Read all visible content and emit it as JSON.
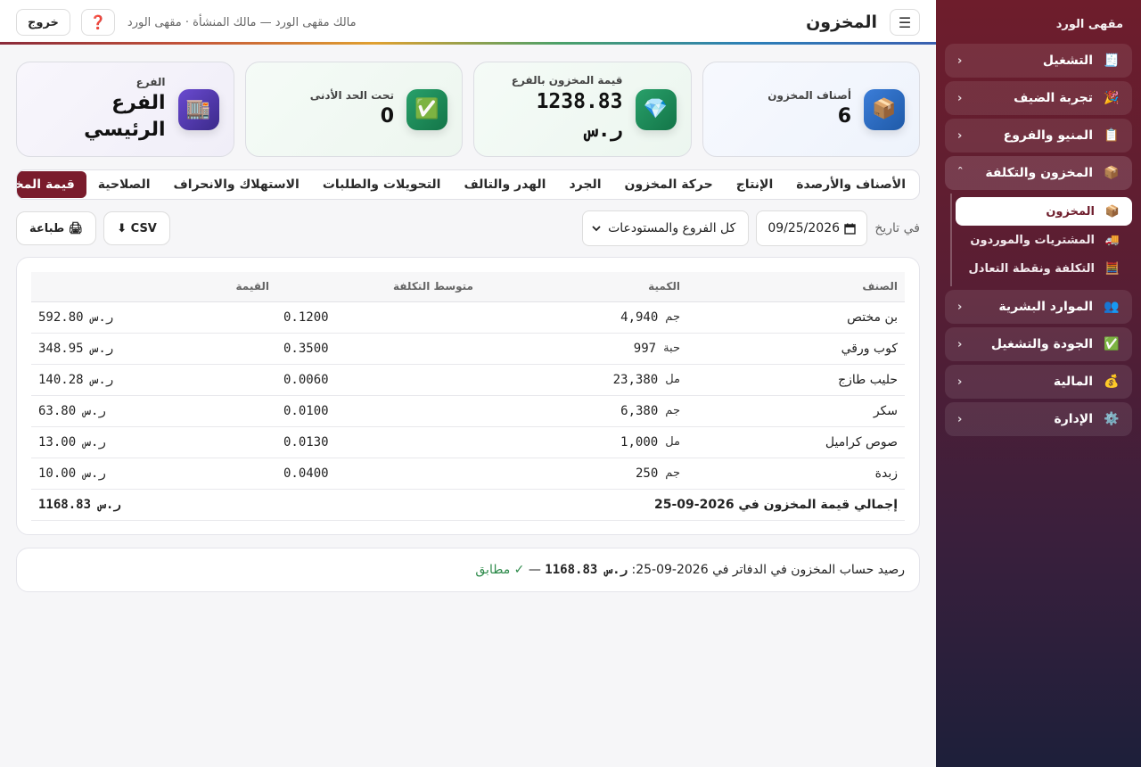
{
  "sidebar": {
    "brand": "مقهى الورد",
    "items": [
      {
        "icon": "🧾",
        "label": "التشغيل",
        "chevron": "‹"
      },
      {
        "icon": "🎉",
        "label": "تجربة الضيف",
        "chevron": "‹"
      },
      {
        "icon": "📋",
        "label": "المنيو والفروع",
        "chevron": "‹"
      },
      {
        "icon": "📦",
        "label": "المخزون والتكلفة",
        "chevron": "‹"
      },
      {
        "icon": "👥",
        "label": "الموارد البشرية",
        "chevron": "‹"
      },
      {
        "icon": "✅",
        "label": "الجودة والتشغيل",
        "chevron": "‹"
      },
      {
        "icon": "💰",
        "label": "المالية",
        "chevron": "‹"
      },
      {
        "icon": "⚙️",
        "label": "الإدارة",
        "chevron": "‹"
      }
    ],
    "sub_items": [
      {
        "icon": "📦",
        "label": "المخزون"
      },
      {
        "icon": "🚚",
        "label": "المشتريات والموردون"
      },
      {
        "icon": "🧮",
        "label": "التكلفة ونقطة التعادل"
      }
    ]
  },
  "topbar": {
    "menu_icon": "☰",
    "title": "المخزون",
    "breadcrumb": "مالك مقهى الورد — مالك المنشأة · مقهى الورد",
    "help_icon": "❓",
    "logout": "خروج"
  },
  "kpis": [
    {
      "icon": "📦",
      "label": "أصناف المخزون",
      "value": "6"
    },
    {
      "icon": "💎",
      "label": "قيمة المخزون بالفرع",
      "value": "1238.83",
      "unit": "ر.س"
    },
    {
      "icon": "✅",
      "label": "تحت الحد الأدنى",
      "value": "0"
    },
    {
      "icon": "🏬",
      "label": "الفرع",
      "value": "الفرع الرئيسي"
    }
  ],
  "tabs": [
    "الأصناف والأرصدة",
    "الإنتاج",
    "حركة المخزون",
    "الجرد",
    "الهدر والتالف",
    "التحويلات والطلبات",
    "الاستهلاك والانحراف",
    "الصلاحية",
    "قيمة المخزون"
  ],
  "filters": {
    "date_label": "في تاريخ",
    "date_value": "09/25/2026",
    "branch_select": "كل الفروع والمستودعات",
    "csv_button": "CSV ⬇",
    "print_button": "🖨 طباعة"
  },
  "table": {
    "headers": [
      "الصنف",
      "الكمية",
      "متوسط التكلفة",
      "القيمة"
    ],
    "rows": [
      {
        "name": "بن مختص",
        "unit": "جم",
        "qty": "4,940",
        "avg": "0.1200",
        "value": "ر.س 592.80"
      },
      {
        "name": "كوب ورقي",
        "unit": "حبة",
        "qty": "997",
        "avg": "0.3500",
        "value": "ر.س 348.95"
      },
      {
        "name": "حليب طازج",
        "unit": "مل",
        "qty": "23,380",
        "avg": "0.0060",
        "value": "ر.س 140.28"
      },
      {
        "name": "سكر",
        "unit": "جم",
        "qty": "6,380",
        "avg": "0.0100",
        "value": "ر.س 63.80"
      },
      {
        "name": "صوص كراميل",
        "unit": "مل",
        "qty": "1,000",
        "avg": "0.0130",
        "value": "ر.س 13.00"
      },
      {
        "name": "زبدة",
        "unit": "جم",
        "qty": "250",
        "avg": "0.0400",
        "value": "ر.س 10.00"
      }
    ],
    "total_label": "إجمالي قيمة المخزون في 2026-09-25",
    "total_value": "ر.س 1168.83"
  },
  "ledger": {
    "text": "رصيد حساب المخزون في الدفاتر في 2026-09-25:",
    "amount": "ر.س 1168.83",
    "dash": "—",
    "match": "✓ مطابق"
  },
  "colors": {
    "accent": "#7a1c2c",
    "sidebar_top": "#6e1d2c",
    "sidebar_bottom": "#1d1f3a",
    "success": "#2d8a4a"
  }
}
